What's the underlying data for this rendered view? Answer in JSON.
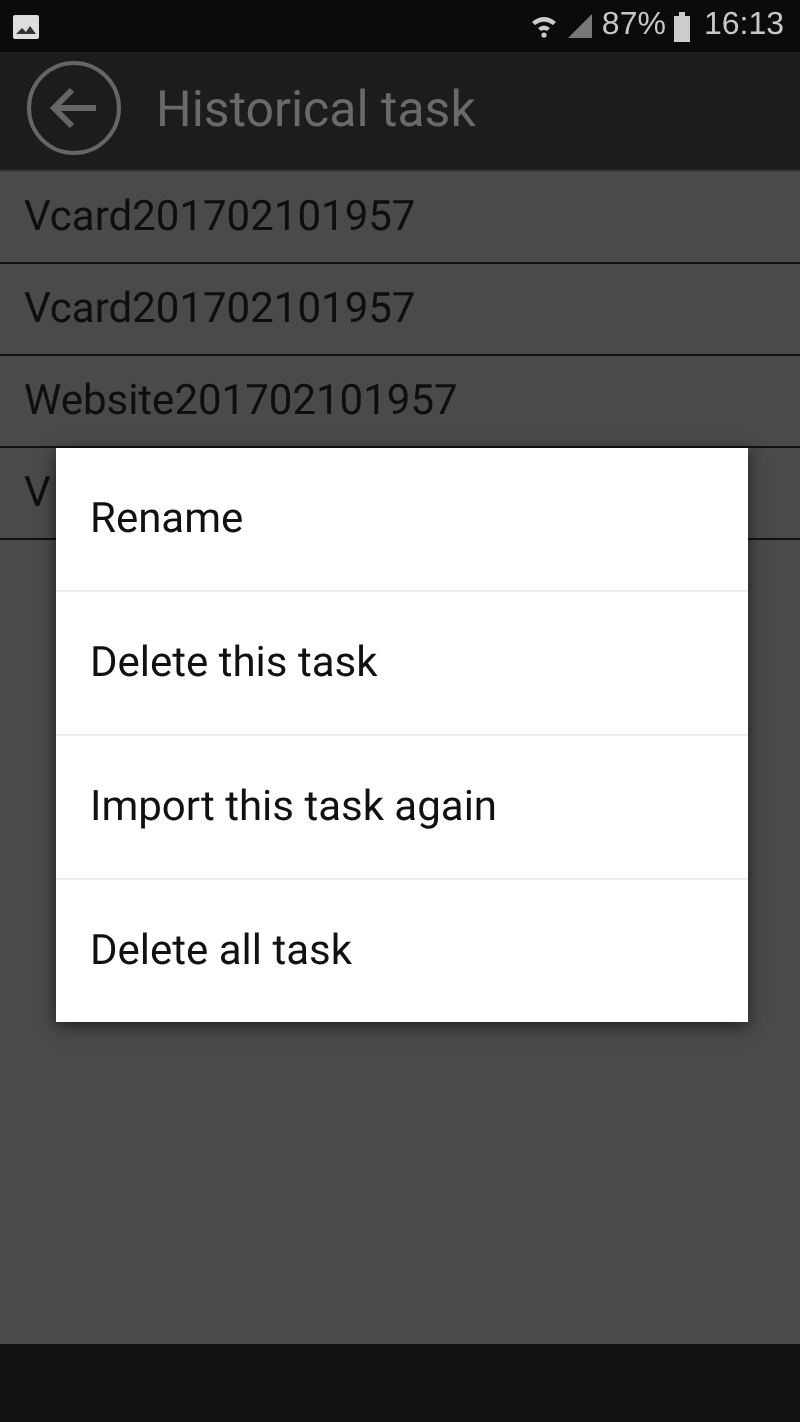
{
  "status_bar": {
    "battery": "87%",
    "time": "16:13"
  },
  "app_bar": {
    "title": "Historical task"
  },
  "tasks": [
    {
      "name": "Vcard201702101957"
    },
    {
      "name": "Vcard201702101957"
    },
    {
      "name": "Website201702101957"
    },
    {
      "name": "V"
    }
  ],
  "menu": {
    "items": [
      "Rename",
      "Delete this task",
      "Import this task again",
      "Delete all task"
    ]
  }
}
